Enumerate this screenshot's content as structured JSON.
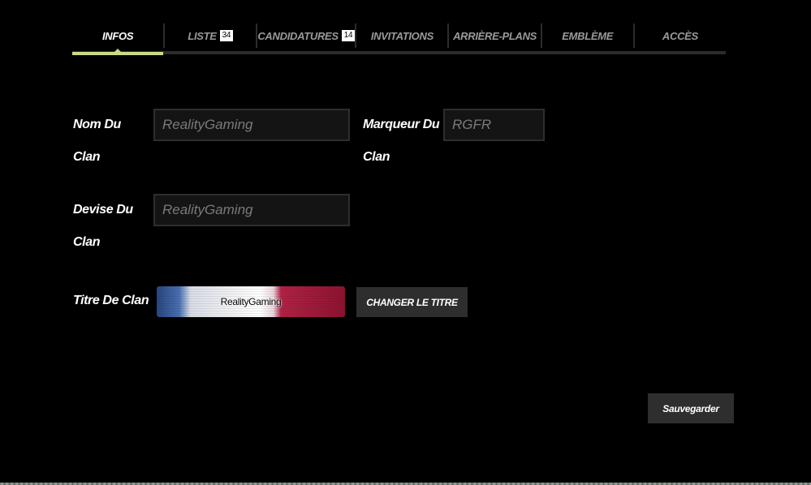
{
  "tabs": [
    {
      "label": "INFOS",
      "active": true
    },
    {
      "label": "LISTE",
      "badge": "34"
    },
    {
      "label": "CANDIDATURES",
      "badge": "14"
    },
    {
      "label": "INVITATIONS"
    },
    {
      "label": "ARRIÈRE-PLANS"
    },
    {
      "label": "EMBLÈME"
    },
    {
      "label": "ACCÈS"
    }
  ],
  "form": {
    "clan_name_label": "Nom Du Clan",
    "clan_name_value": "RealityGaming",
    "clan_tag_label": "Marqueur Du Clan",
    "clan_tag_value": "RGFR",
    "clan_motto_label": "Devise Du Clan",
    "clan_motto_value": "RealityGaming",
    "clan_title_label": "Titre De Clan",
    "clan_title_banner_text": "RealityGaming",
    "change_title_button": "CHANGER LE TITRE",
    "save_button": "Sauvegarder"
  },
  "colors": {
    "background": "#000000",
    "active_tab_underline": "#c8dc86",
    "button_bg": "#2e2e2e",
    "field_bg": "#141414"
  }
}
